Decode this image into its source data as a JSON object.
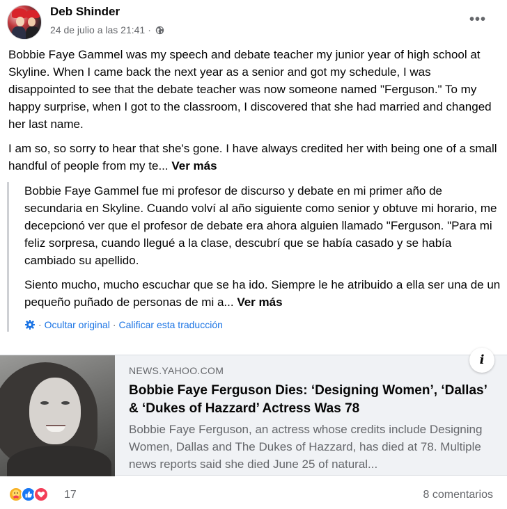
{
  "post": {
    "author": "Deb Shinder",
    "timestamp": "24 de julio a las 21:41",
    "separator": "·",
    "privacy_icon": "globe-icon",
    "more_label": "•••",
    "paragraphs": [
      "Bobbie Faye Gammel was my speech and debate teacher my junior year of high school at Skyline. When I came back the next year as a senior and got my schedule, I was disappointed to see that the debate teacher was now someone named \"Ferguson.\" To my happy surprise, when I got to the classroom, I discovered that she had married and changed her last name.",
      "I am so, so sorry to hear that she's gone. I have always credited her with being one of a small handful of people from my te..."
    ],
    "see_more": "Ver más"
  },
  "translation": {
    "paragraphs": [
      "Bobbie Faye Gammel fue mi profesor de discurso y debate en mi primer año de secundaria en Skyline. Cuando volví al año siguiente como senior y obtuve mi horario, me decepcionó ver que el profesor de debate era ahora alguien llamado \"Ferguson. \"Para mi feliz sorpresa, cuando llegué a la clase, descubrí que se había casado y se había cambiado su apellido.",
      "Siento mucho, mucho escuchar que se ha ido. Siempre le he atribuido a ella ser una de un pequeño puñado de personas de mi a..."
    ],
    "see_more": "Ver más",
    "hide_original": "Ocultar original",
    "rate": "Calificar esta traducción",
    "separator": "·"
  },
  "link_card": {
    "domain": "NEWS.YAHOO.COM",
    "title": "Bobbie Faye Ferguson Dies: ‘Designing Women’, ‘Dallas’ & ‘Dukes of Hazzard’ Actress Was 78",
    "description": "Bobbie Faye Ferguson, an actress whose credits include Designing Women, Dallas and The Dukes of Hazzard, has died at 78. Multiple news reports said she died June 25 of natural...",
    "info_label": "i"
  },
  "footer": {
    "reaction_icons": [
      "care-icon",
      "like-icon",
      "love-icon"
    ],
    "reaction_count": "17",
    "comments": "8 comentarios"
  },
  "colors": {
    "link_blue": "#1b74e4",
    "secondary_text": "#65676b",
    "card_bg": "#f0f2f5",
    "like_blue": "#1877f2",
    "love_red": "#f33e58",
    "care_yellow": "#f7b125"
  }
}
